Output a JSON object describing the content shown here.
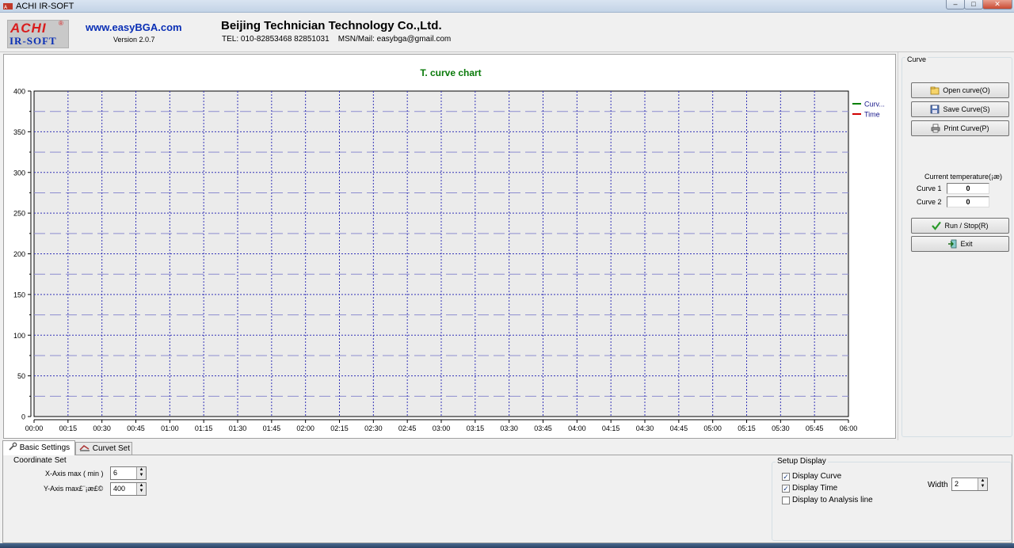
{
  "window": {
    "title": "ACHI IR-SOFT",
    "minimize": "–",
    "maximize": "□",
    "close": "✕"
  },
  "header": {
    "logo_top": "ACHI",
    "logo_reg": "®",
    "logo_bottom": "IR-SOFT",
    "website": "www.easyBGA.com",
    "version": "Version 2.0.7",
    "company": "Beijing Technician Technology Co.,Ltd.",
    "contact": "TEL: 010-82853468 82851031    MSN/Mail: easybga@gmail.com"
  },
  "chart_data": {
    "type": "line",
    "title": "T. curve chart",
    "xlabel": "",
    "ylabel": "",
    "ylim": [
      0,
      400
    ],
    "y_ticks": [
      0,
      50,
      100,
      150,
      200,
      250,
      300,
      350,
      400
    ],
    "x_tick_labels": [
      "00:00",
      "00:15",
      "00:30",
      "00:45",
      "01:00",
      "01:15",
      "01:30",
      "01:45",
      "02:00",
      "02:15",
      "02:30",
      "02:45",
      "03:00",
      "03:15",
      "03:30",
      "03:45",
      "04:00",
      "04:15",
      "04:30",
      "04:45",
      "05:00",
      "05:15",
      "05:30",
      "05:45",
      "06:00"
    ],
    "grid": true,
    "legend_position": "top-right",
    "series": [
      {
        "name": "Curv...",
        "color": "#008000",
        "values": []
      },
      {
        "name": "Time",
        "color": "#d00000",
        "values": []
      }
    ]
  },
  "right_panel": {
    "group_label": "Curve",
    "open_curve": "Open curve(O)",
    "save_curve": "Save Curve(S)",
    "print_curve": "Print Curve(P)",
    "current_temp_label": "Current temperature(¡æ)",
    "curve1_label": "Curve 1",
    "curve1_value": "0",
    "curve2_label": "Curve 2",
    "curve2_value": "0",
    "run_stop": "Run / Stop(R)",
    "exit": "Exit"
  },
  "tabs": {
    "basic_settings": "Basic Settings",
    "curve_set": "Curvet Set"
  },
  "coordinate_set": {
    "label": "Coordinate Set",
    "x_axis_label": "X-Axis max ( min )",
    "x_axis_value": "6",
    "y_axis_label": "Y-Axis max£¨¡æ£©",
    "y_axis_value": "400"
  },
  "setup_display": {
    "label": "Setup Display",
    "display_curve": "Display Curve",
    "display_curve_checked": true,
    "display_time": "Display Time",
    "display_time_checked": true,
    "display_analysis": "Display to Analysis line",
    "display_analysis_checked": false,
    "width_label": "Width",
    "width_value": "2"
  }
}
